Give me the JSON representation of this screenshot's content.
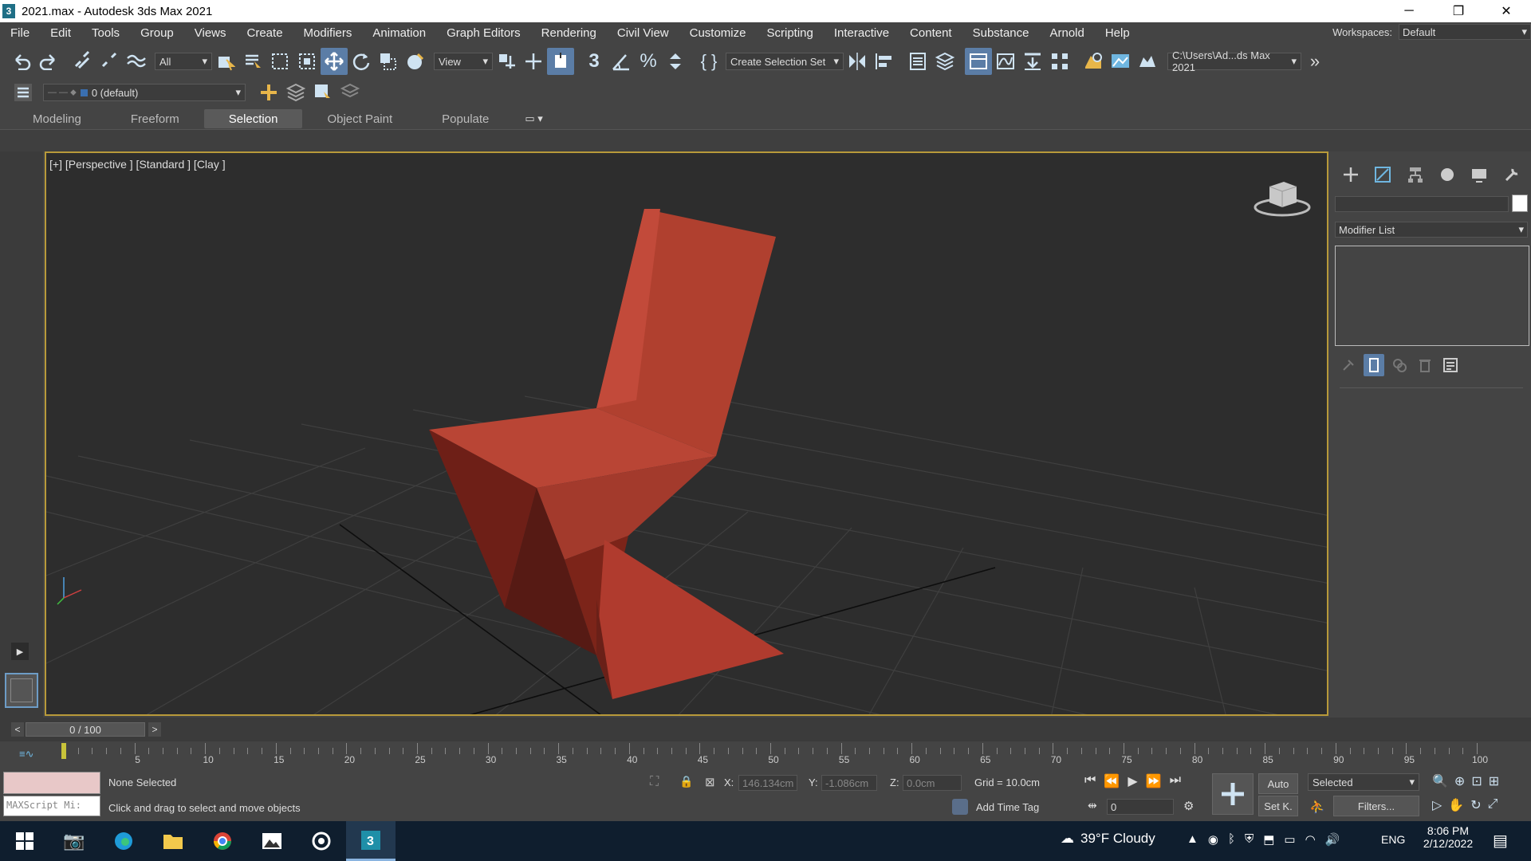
{
  "window": {
    "app_icon_text": "3",
    "title": "2021.max - Autodesk 3ds Max 2021",
    "min_glyph": "─",
    "max_glyph": "❐",
    "close_glyph": "✕"
  },
  "menu": {
    "items": [
      "File",
      "Edit",
      "Tools",
      "Group",
      "Views",
      "Create",
      "Modifiers",
      "Animation",
      "Graph Editors",
      "Rendering",
      "Civil View",
      "Customize",
      "Scripting",
      "Interactive",
      "Content",
      "Substance",
      "Arnold",
      "Help"
    ],
    "workspaces_label": "Workspaces:",
    "workspace_value": "Default"
  },
  "toolbar": {
    "selection_filter": "All",
    "ref_coord": "View",
    "named_selection": "Create Selection Set",
    "project_path": "C:\\Users\\Ad...ds Max 2021"
  },
  "layer_bar": {
    "layer_name": "0 (default)"
  },
  "ribbon": {
    "tabs": [
      {
        "label": "Modeling",
        "active": false
      },
      {
        "label": "Freeform",
        "active": false
      },
      {
        "label": "Selection",
        "active": true
      },
      {
        "label": "Object Paint",
        "active": false
      },
      {
        "label": "Populate",
        "active": false
      }
    ]
  },
  "viewport": {
    "label": "[+] [Perspective ] [Standard ] [Clay ]",
    "object_color": "#b03a2e",
    "border_color": "#b89a3a"
  },
  "command_panel": {
    "modifier_list": "Modifier List"
  },
  "time": {
    "frame_display": "0 / 100",
    "prev_glyph": "<",
    "next_glyph": ">",
    "ticks": [
      "5",
      "10",
      "15",
      "20",
      "25",
      "30",
      "35",
      "40",
      "45",
      "50",
      "55",
      "60",
      "65",
      "70",
      "75",
      "80",
      "85",
      "90",
      "95",
      "100"
    ]
  },
  "status": {
    "selection": "None Selected",
    "prompt": "Click and drag to select and move objects",
    "maxscript_placeholder": "MAXScript Mi:",
    "x_label": "X:",
    "x_value": "146.134cm",
    "y_label": "Y:",
    "y_value": "-1.086cm",
    "z_label": "Z:",
    "z_value": "0.0cm",
    "grid": "Grid = 10.0cm",
    "add_time_tag": "Add Time Tag",
    "auto_label": "Auto",
    "setkey_label": "Set K.",
    "key_mode": "Selected",
    "filters_label": "Filters...",
    "frame_value": "0"
  },
  "taskbar": {
    "weather": "39°F  Cloudy",
    "lang": "ENG",
    "time": "8:06 PM",
    "date": "2/12/2022",
    "apps": [
      "windows-start",
      "camera",
      "edge",
      "file-explorer",
      "chrome",
      "photos",
      "media",
      "3ds-max"
    ]
  }
}
